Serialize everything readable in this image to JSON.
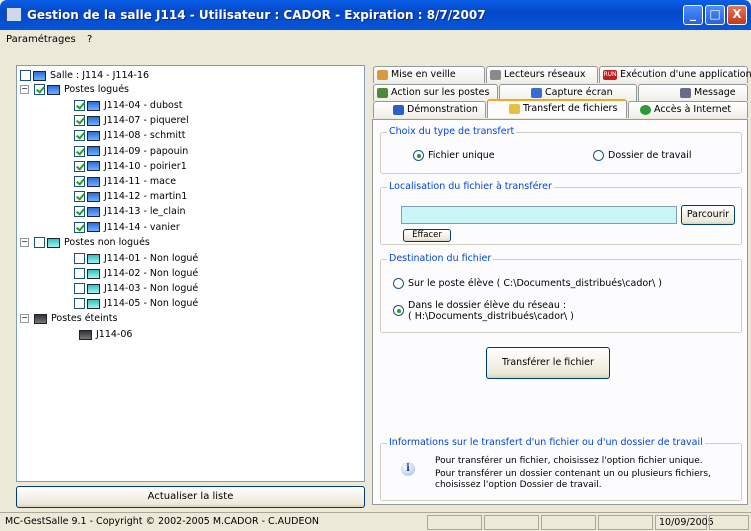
{
  "window": {
    "title": "Gestion de la salle J114 - Utilisateur : CADOR - Expiration  : 8/7/2007",
    "minimize": "_",
    "maximize": "□",
    "close": "X"
  },
  "menu": [
    "Paramétrages",
    "?"
  ],
  "tree": {
    "root": "Salle : J114 - J114-16",
    "logged_group": "Postes logués",
    "logged": [
      "J114-04 - dubost",
      "J114-07 - piquerel",
      "J114-08 - schmitt",
      "J114-09 - papouin",
      "J114-10 - poirier1",
      "J114-11 - mace",
      "J114-12 - martin1",
      "J114-13 - le_clain",
      "J114-14 - vanier"
    ],
    "notlogged_group": "Postes non logués",
    "notlogged": [
      "J114-01 - Non logué",
      "J114-02 - Non logué",
      "J114-03 - Non logué",
      "J114-05 - Non logué"
    ],
    "off_group": "Postes éteints",
    "off": [
      "J114-06"
    ]
  },
  "refresh_button": "Actualiser la liste",
  "tabs": {
    "row1": [
      "Mise en veille",
      "Lecteurs réseaux",
      "Exécution d'une application"
    ],
    "row2": [
      "Action sur les postes",
      "Capture écran",
      "Message"
    ],
    "row3": [
      "Démonstration",
      "Transfert de fichiers",
      "Accès à Internet"
    ],
    "active": "Transfert de fichiers",
    "exec_badge": "RUN"
  },
  "transfer_type": {
    "legend": "Choix du type de transfert",
    "option_file": "Fichier unique",
    "option_folder": "Dossier de travail",
    "selected": "Fichier unique"
  },
  "location": {
    "legend": "Localisation du fichier à transférer",
    "value": "",
    "browse": "Parcourir",
    "clear": "Effacer"
  },
  "destination": {
    "legend": "Destination du fichier",
    "option1": "Sur le poste élève ( C:\\Documents_distribués\\cador\\ )",
    "option2_line1": "Dans le dossier élève du réseau :",
    "option2_line2": "( H:\\Documents_distribués\\cador\\ )",
    "selected": "option2"
  },
  "transfer_button": "Transférer le fichier",
  "info": {
    "legend": "Informations sur le transfert d'un fichier ou d'un dossier de travail",
    "line1": "Pour transférer un fichier, choisissez l'option fichier unique.",
    "line2": "Pour transférer un dossier contenant un ou plusieurs fichiers,",
    "line3": "choisissez l'option Dossier de travail.",
    "icon": "i"
  },
  "status": {
    "copyright": "MC-GestSalle 9.1 - Copyright © 2002-2005  M.CADOR - C.AUDEON",
    "date": "10/09/2005"
  }
}
